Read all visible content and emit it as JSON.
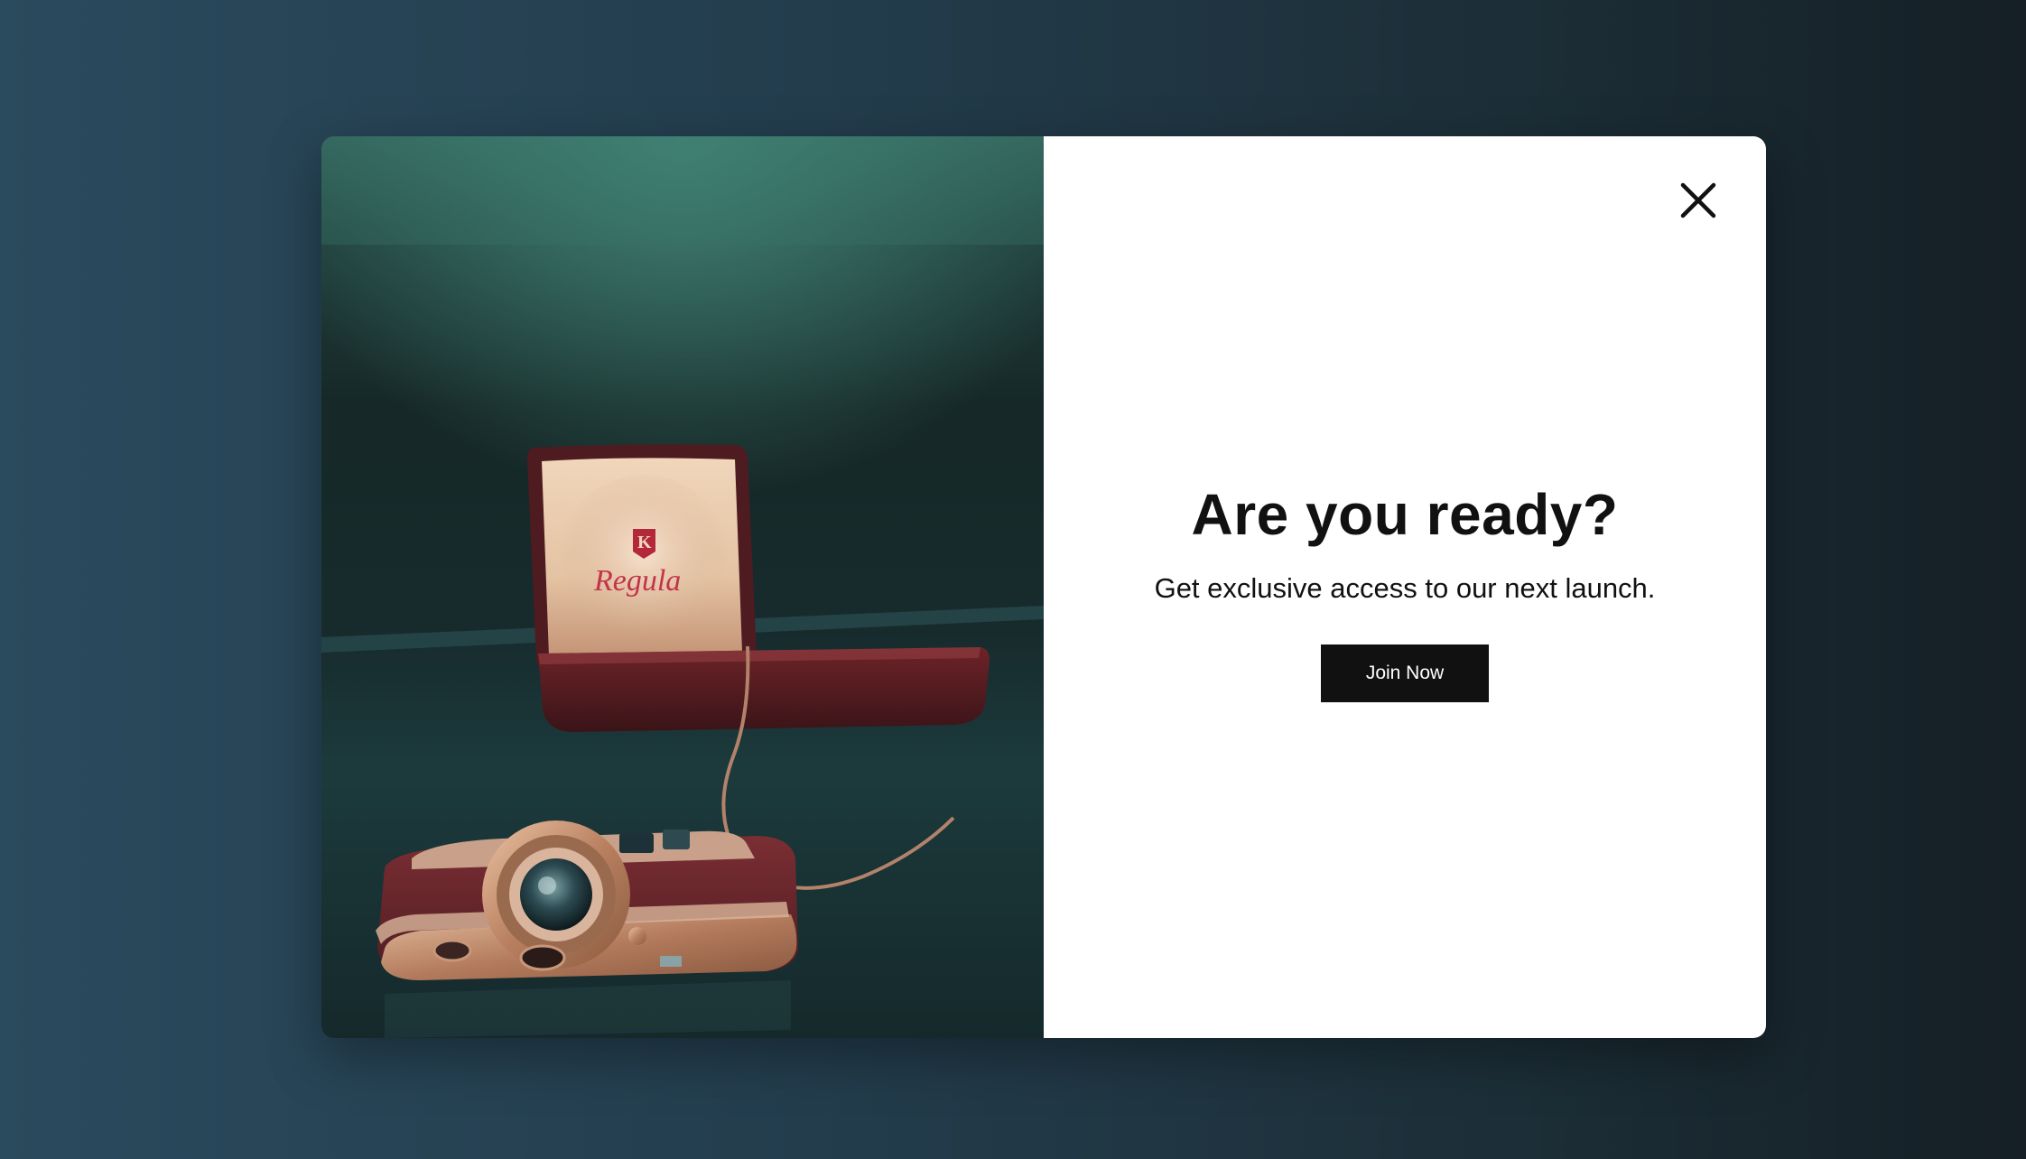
{
  "modal": {
    "headline": "Are you ready?",
    "subtitle": "Get exclusive access to our next launch.",
    "cta_label": "Join Now",
    "close_icon": "close-icon"
  },
  "photo": {
    "box_brand_text": "Regula",
    "colors": {
      "camera_body": "#6b2a2c",
      "brass": "#c8977a",
      "box_lining": "#e7c9ad",
      "box_outer": "#5a1f24"
    }
  },
  "colors": {
    "background_left": "#2a4a5d",
    "background_right": "#151f25",
    "button_bg": "#111111",
    "button_text": "#ffffff",
    "panel_bg": "#ffffff"
  }
}
